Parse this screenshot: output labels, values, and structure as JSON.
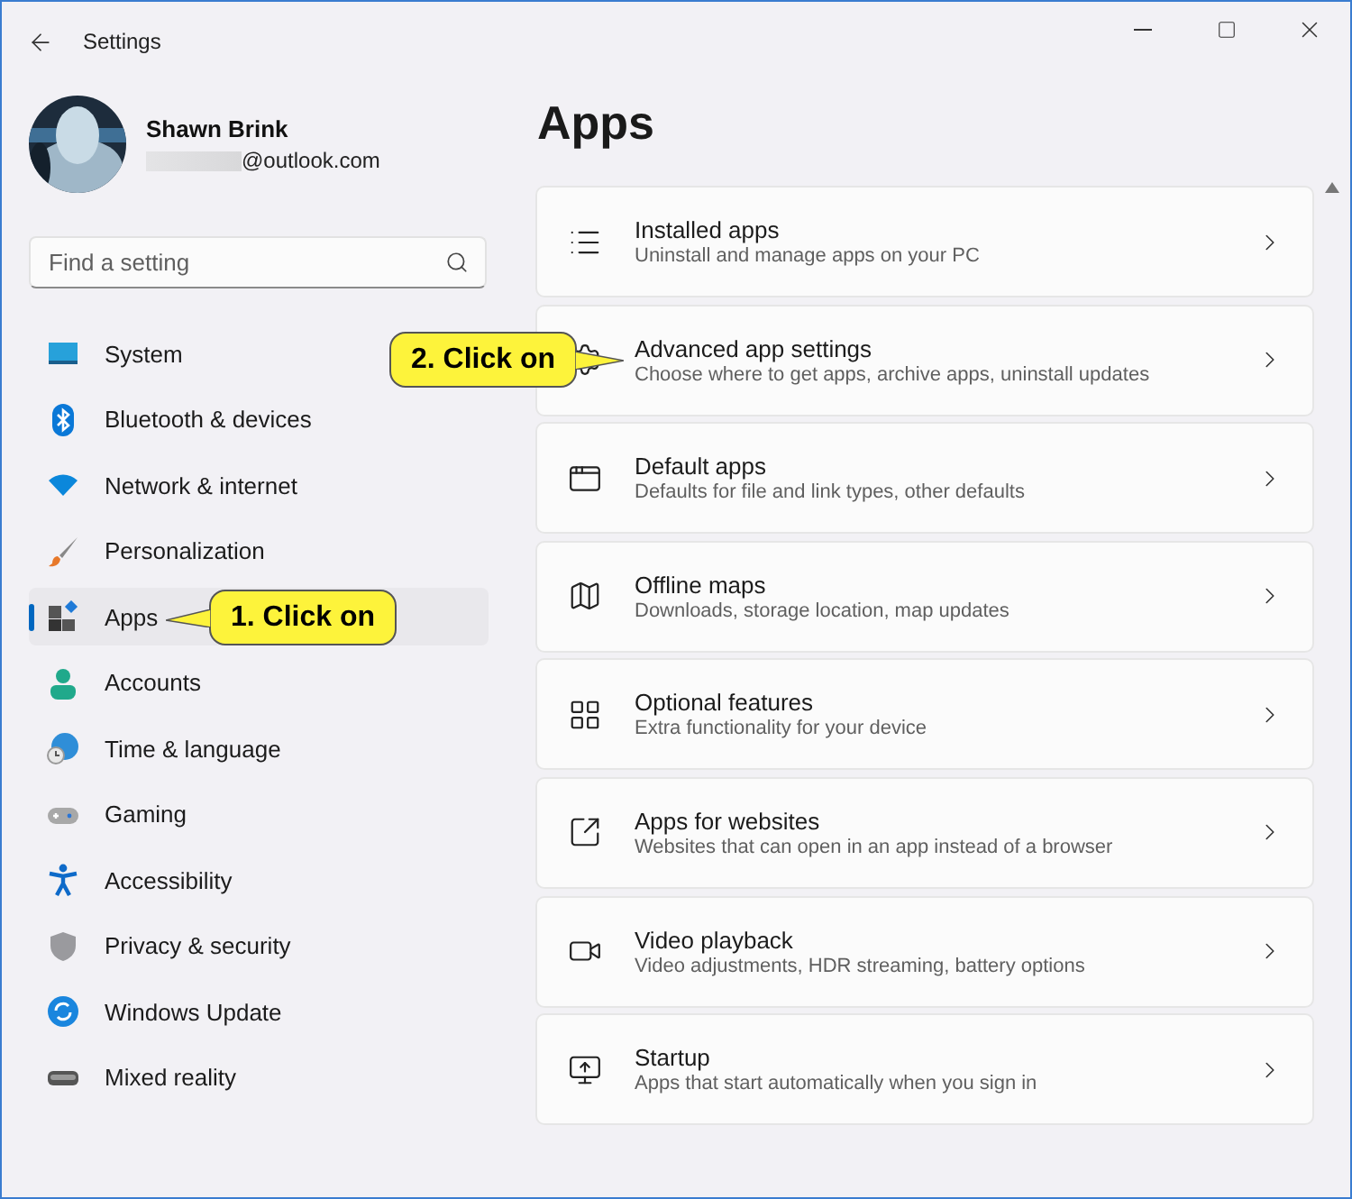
{
  "window": {
    "title": "Settings"
  },
  "account": {
    "name": "Shawn Brink",
    "email": "@outlook.com"
  },
  "search": {
    "placeholder": "Find a setting"
  },
  "sidebar": {
    "items": [
      {
        "label": "System",
        "kind": "system",
        "selected": false
      },
      {
        "label": "Bluetooth & devices",
        "kind": "bluetooth",
        "selected": false
      },
      {
        "label": "Network & internet",
        "kind": "network",
        "selected": false
      },
      {
        "label": "Personalization",
        "kind": "brush",
        "selected": false
      },
      {
        "label": "Apps",
        "kind": "apps",
        "selected": true
      },
      {
        "label": "Accounts",
        "kind": "accounts",
        "selected": false
      },
      {
        "label": "Time & language",
        "kind": "time",
        "selected": false
      },
      {
        "label": "Gaming",
        "kind": "gaming",
        "selected": false
      },
      {
        "label": "Accessibility",
        "kind": "accessibility",
        "selected": false
      },
      {
        "label": "Privacy & security",
        "kind": "privacy",
        "selected": false
      },
      {
        "label": "Windows Update",
        "kind": "update",
        "selected": false
      },
      {
        "label": "Mixed reality",
        "kind": "mixed",
        "selected": false
      }
    ]
  },
  "page": {
    "title": "Apps",
    "items": [
      {
        "title": "Installed apps",
        "description": "Uninstall and manage apps on your PC",
        "kind": "list"
      },
      {
        "title": "Advanced app settings",
        "description": "Choose where to get apps, archive apps, uninstall updates",
        "kind": "gear"
      },
      {
        "title": "Default apps",
        "description": "Defaults for file and link types, other defaults",
        "kind": "default"
      },
      {
        "title": "Offline maps",
        "description": "Downloads, storage location, map updates",
        "kind": "map"
      },
      {
        "title": "Optional features",
        "description": "Extra functionality for your device",
        "kind": "features"
      },
      {
        "title": "Apps for websites",
        "description": "Websites that can open in an app instead of a browser",
        "kind": "web"
      },
      {
        "title": "Video playback",
        "description": "Video adjustments, HDR streaming, battery options",
        "kind": "video"
      },
      {
        "title": "Startup",
        "description": "Apps that start automatically when you sign in",
        "kind": "startup"
      }
    ]
  },
  "callouts": [
    {
      "text": "1. Click on"
    },
    {
      "text": "2. Click on"
    }
  ]
}
